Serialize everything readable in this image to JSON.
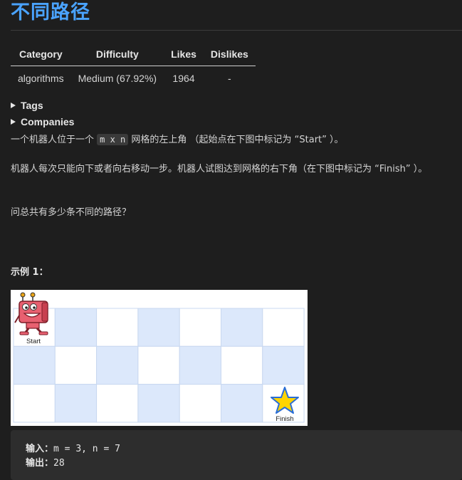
{
  "problem": {
    "title": "不同路径"
  },
  "meta_table": {
    "headers": [
      "Category",
      "Difficulty",
      "Likes",
      "Dislikes"
    ],
    "row": [
      "algorithms",
      "Medium (67.92%)",
      "1964",
      "-"
    ]
  },
  "toggles": {
    "tags": "Tags",
    "companies": "Companies"
  },
  "description": {
    "p1_before": "一个机器人位于一个 ",
    "p1_code": "m x n",
    "p1_after": " 网格的左上角 （起始点在下图中标记为 “Start” ）。",
    "p2": "机器人每次只能向下或者向右移动一步。机器人试图达到网格的右下角（在下图中标记为 “Finish” ）。",
    "p3": "问总共有多少条不同的路径？"
  },
  "example": {
    "title": "示例 1：",
    "figure": {
      "start_label": "Start",
      "finish_label": "Finish",
      "rows": 3,
      "cols": 7,
      "shaded_color": "#dce8fb",
      "white_color": "#ffffff"
    },
    "input_label": "输入：",
    "input_value": "m = 3, n = 7",
    "output_label": "输出：",
    "output_value": "28"
  },
  "colors": {
    "background": "#1e1e1e",
    "title": "#4aa3ff",
    "text": "#d4d4d4",
    "code_bg": "#2d2d2d"
  }
}
